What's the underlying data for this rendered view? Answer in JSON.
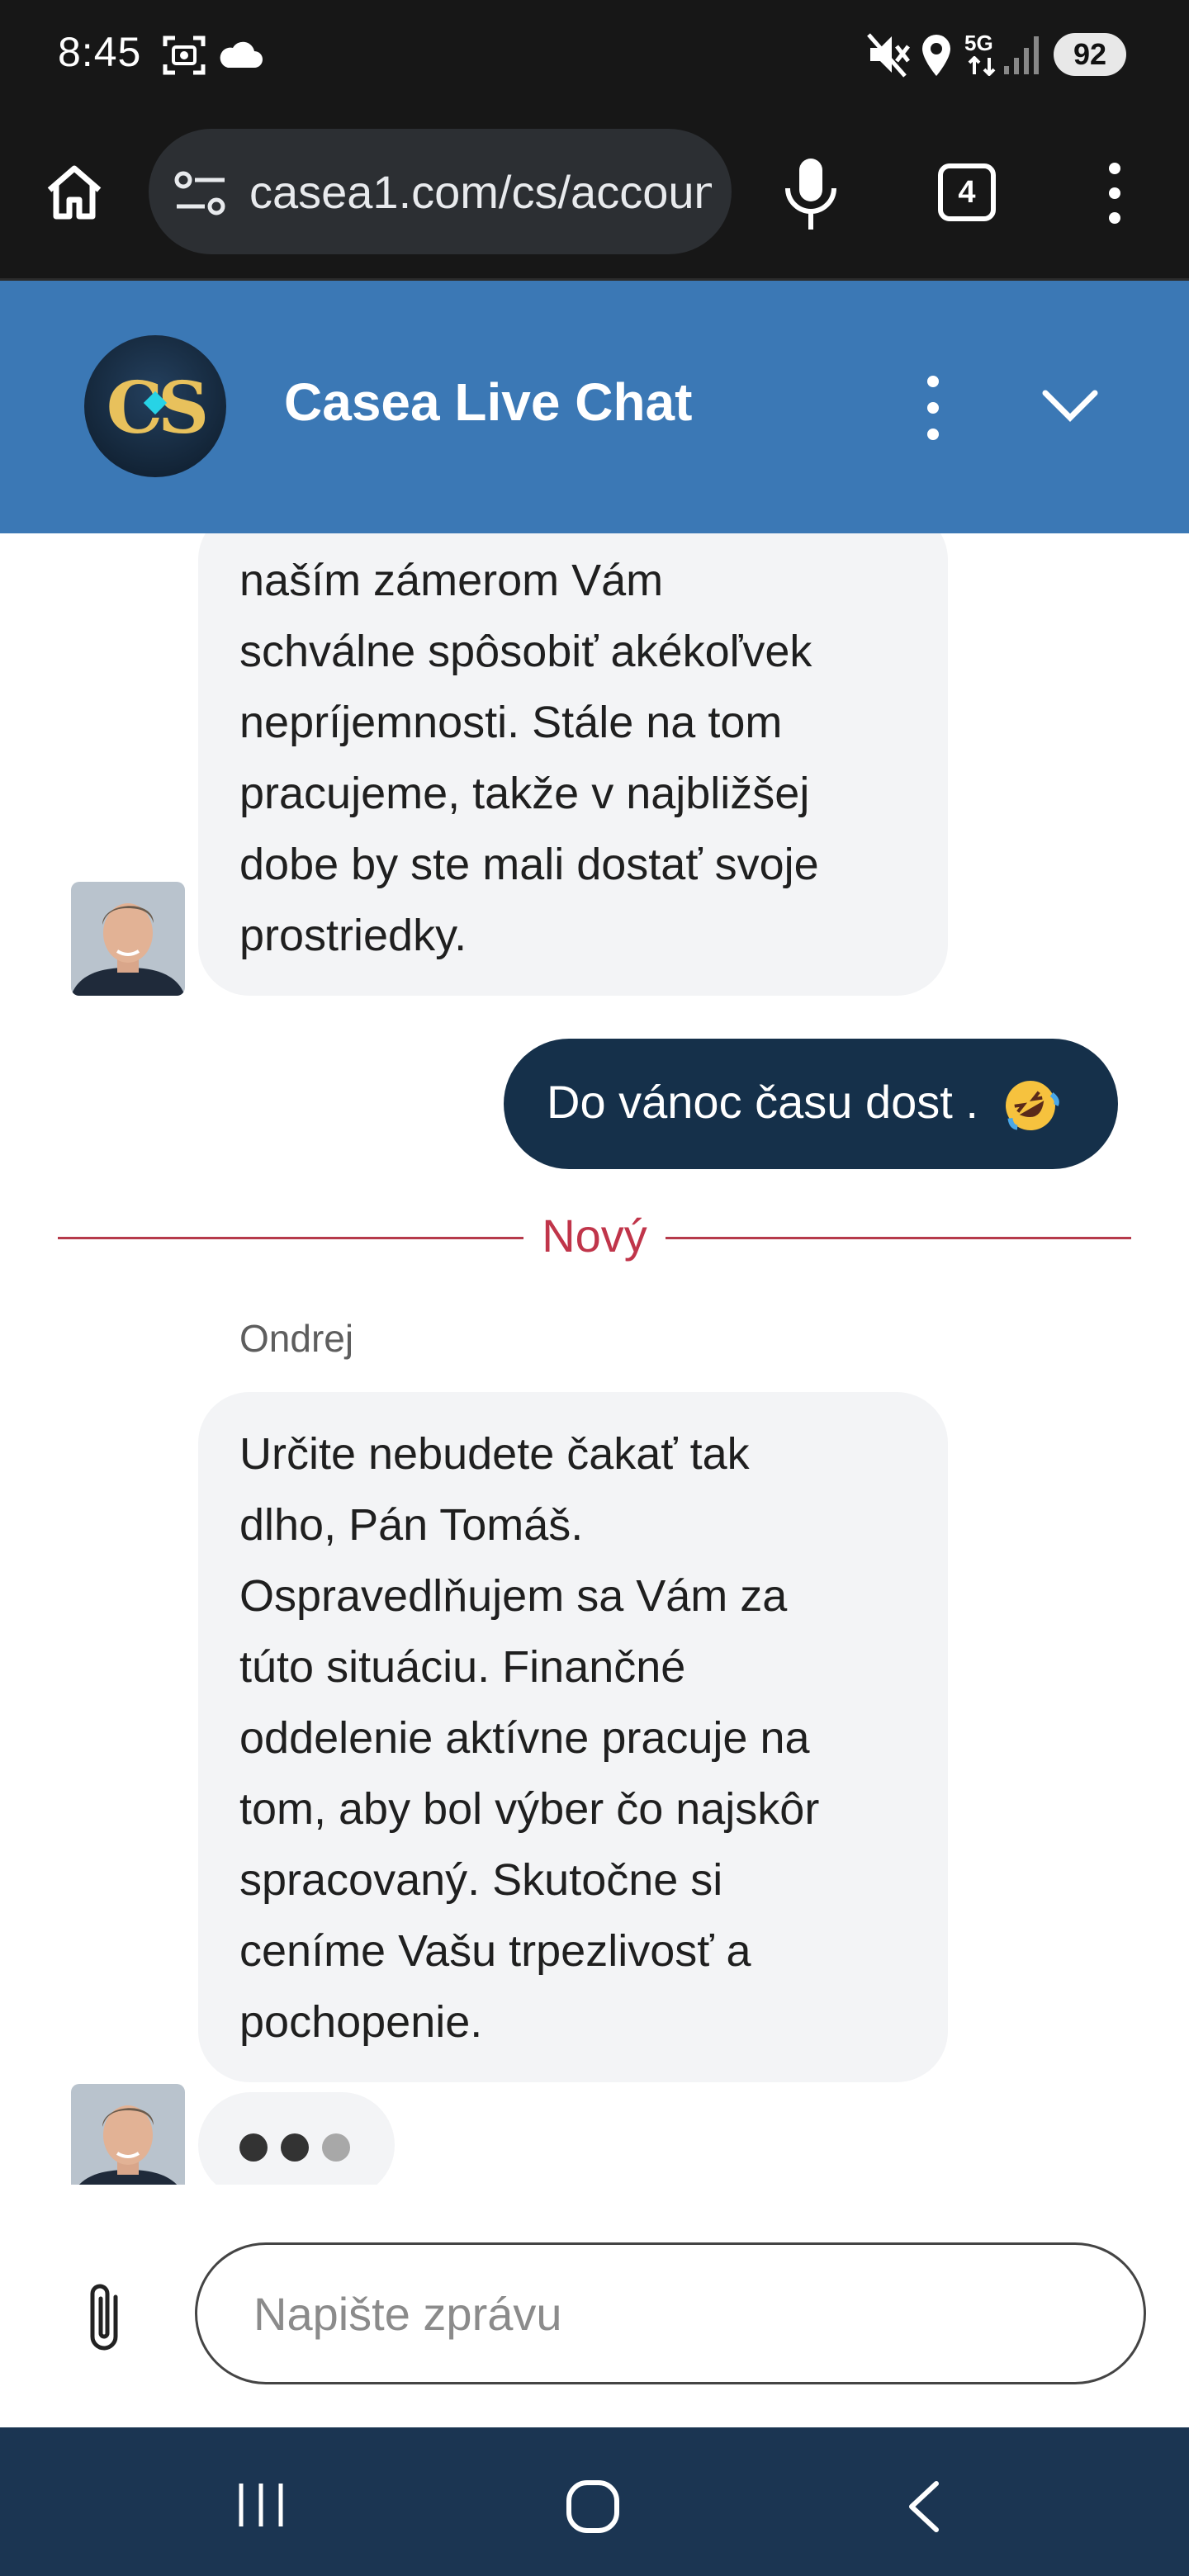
{
  "status_bar": {
    "time": "8:45",
    "battery": "92",
    "network": "5G",
    "icons": [
      "screenshot-icon",
      "cloud-icon",
      "mute-icon",
      "location-icon",
      "signal-icon",
      "battery-icon"
    ]
  },
  "browser": {
    "url": "casea1.com/cs/account",
    "tab_count": "4",
    "icons": [
      "home-icon",
      "site-settings-icon",
      "mic-icon",
      "tabs-icon",
      "menu-icon"
    ]
  },
  "chat_header": {
    "logo_text": "CS",
    "title": "Casea Live Chat",
    "icons": [
      "more-vert-icon",
      "chevron-down-icon"
    ],
    "accent": "#3b78b5"
  },
  "messages": {
    "agent_message_1": "naším zámerom Vám\nschválne spôsobiť akékoľvek\nnepríjemnosti. Stále na tom\npracujeme, takže v najbližšej\ndobe by ste mali dostať svoje\nprostriedky.",
    "user_message": "Do vánoc času dost .",
    "user_emoji": "rolling-on-floor-laughing-emoji",
    "divider_label": "Nový",
    "sender_name": "Ondrej",
    "agent_message_2": "Určite nebudete čakať tak\ndlho, Pán Tomáš.\nOspravedlňujem sa Vám za\ntúto situáciu. Finančné\noddelenie aktívne pracuje na\ntom, aby bol výber čo najskôr\nspracovaný. Skutočne si\nceníme Vašu trpezlivosť a\npochopenie.",
    "user_bubble_color": "#15304a",
    "agent_bubble_color": "#f3f4f6",
    "divider_color": "#c0354a"
  },
  "composer": {
    "placeholder": "Napište zprávu",
    "value": "",
    "icons": [
      "attach-icon"
    ]
  },
  "nav_bar": {
    "icons": [
      "recent-apps-icon",
      "home-nav-icon",
      "back-icon"
    ]
  }
}
